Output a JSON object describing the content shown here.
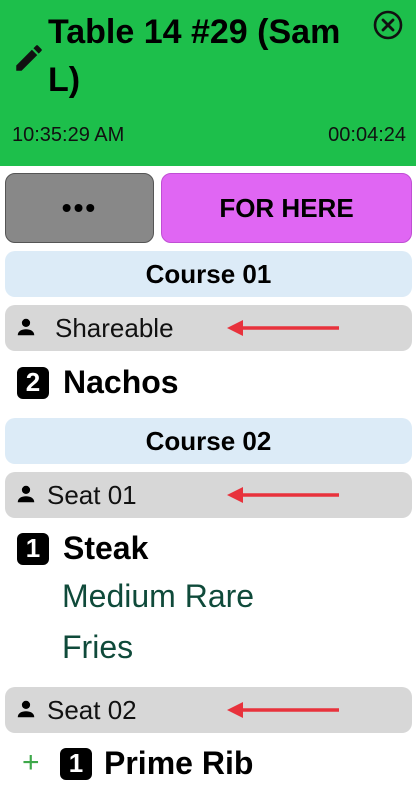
{
  "header": {
    "title": "Table 14 #29 (Sam L)",
    "time_start": "10:35:29 AM",
    "elapsed": "00:04:24",
    "color": "#1dbf4b"
  },
  "actions": {
    "more_label": "•••",
    "order_type_label": "FOR HERE",
    "order_type_color": "#e066f3"
  },
  "courses": [
    {
      "label": "Course 01",
      "seats": [
        {
          "label": "Shareable",
          "items": [
            {
              "qty": "2",
              "name": "Nachos",
              "modifiers": []
            }
          ]
        }
      ]
    },
    {
      "label": "Course 02",
      "seats": [
        {
          "label": "Seat 01",
          "items": [
            {
              "qty": "1",
              "name": "Steak",
              "modifiers": [
                "Medium Rare",
                "Fries"
              ]
            }
          ]
        },
        {
          "label": "Seat 02",
          "items": [
            {
              "qty": "1",
              "name": "Prime Rib",
              "modifiers": [],
              "prefix": "+"
            }
          ]
        }
      ]
    }
  ],
  "icons": {
    "edit": "pencil-icon",
    "close": "close-circle-icon",
    "person": "person-icon",
    "arrow": "left-arrow-indicator"
  },
  "colors": {
    "course_bg": "#dcebf7",
    "seat_bg": "#d7d7d7",
    "modifier_text": "#0f4a3a",
    "arrow": "#e8323c",
    "plus": "#3ea84a"
  }
}
